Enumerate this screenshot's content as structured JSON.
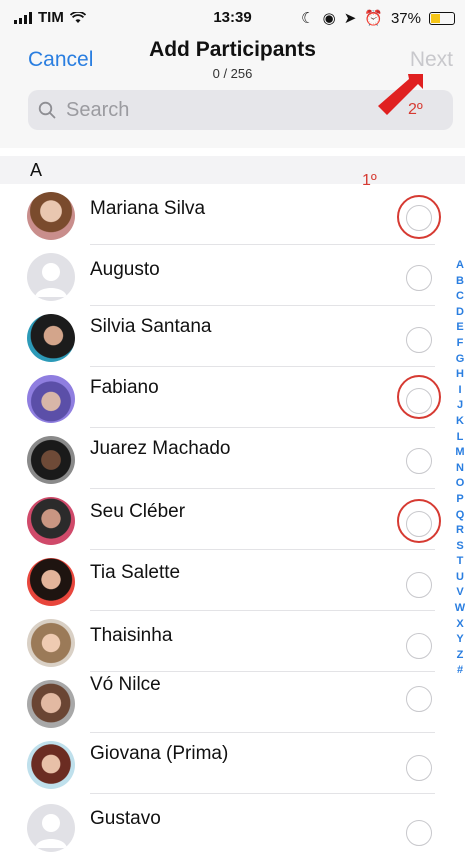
{
  "status": {
    "carrier": "TIM",
    "time": "13:39",
    "battery": "37%"
  },
  "header": {
    "cancel": "Cancel",
    "title": "Add Participants",
    "count": "0 / 256",
    "next": "Next"
  },
  "search": {
    "placeholder": "Search"
  },
  "section": "A",
  "contacts": [
    {
      "name": "Mariana Silva"
    },
    {
      "name": "Augusto"
    },
    {
      "name": "Silvia Santana"
    },
    {
      "name": "Fabiano"
    },
    {
      "name": "Juarez Machado"
    },
    {
      "name": "Seu Cléber"
    },
    {
      "name": "Tia Salette"
    },
    {
      "name": "Thaisinha"
    },
    {
      "name": "Vó Nilce"
    },
    {
      "name": "Giovana (Prima)"
    },
    {
      "name": "Gustavo"
    }
  ],
  "index_letters": [
    "A",
    "B",
    "C",
    "D",
    "E",
    "F",
    "G",
    "H",
    "I",
    "J",
    "K",
    "L",
    "M",
    "N",
    "O",
    "P",
    "Q",
    "R",
    "S",
    "T",
    "U",
    "V",
    "W",
    "X",
    "Y",
    "Z",
    "#"
  ],
  "annotations": {
    "step1": "1º",
    "step2": "2º"
  },
  "colors": {
    "accent": "#2a7ee0",
    "annotation": "#d63a32",
    "disabled": "#c8c8cc"
  }
}
